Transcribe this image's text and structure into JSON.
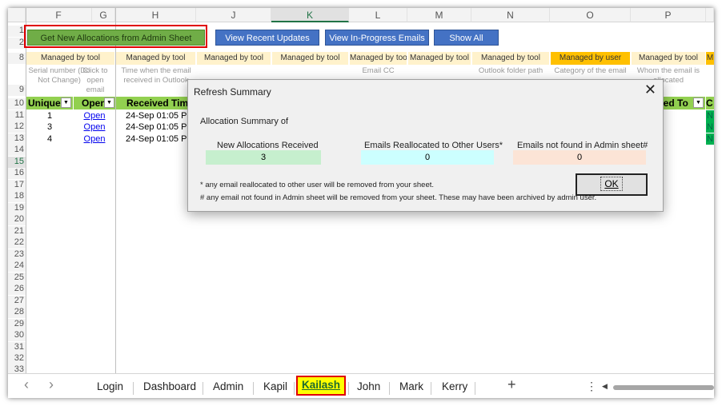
{
  "columns": [
    "F",
    "G",
    "H",
    "J",
    "K",
    "L",
    "M",
    "N",
    "O",
    "P"
  ],
  "rows": [
    "1",
    "2",
    "8",
    "9",
    "10",
    "11",
    "12",
    "13",
    "14",
    "15",
    "16",
    "17",
    "18",
    "19",
    "20",
    "21",
    "22",
    "23",
    "24",
    "25",
    "26",
    "27",
    "28",
    "29",
    "30",
    "31",
    "32",
    "33"
  ],
  "buttons": {
    "get_allocations": "Get New Allocations from Admin Sheet",
    "view_recent": "View Recent Updates",
    "view_inprogress": "View In-Progress Emails",
    "show_all": "Show All"
  },
  "managed": {
    "tool": "Managed by tool",
    "tool_trunc": "Managed by tool",
    "user": "Managed by user",
    "last": "M"
  },
  "descriptions": {
    "serial": "Serial number (Do Not Change)",
    "click": "Click to open email",
    "time": "Time when the email received in Outlook",
    "email_cc": "Email CC",
    "folder": "Outlook folder path",
    "category": "Category of the email",
    "whom": "Whom the email is allocated"
  },
  "headers": {
    "unique": "Unique",
    "open": "Open",
    "received": "Received Time",
    "allocated": "ated To",
    "last": "C"
  },
  "data_rows": [
    {
      "serial": "1",
      "open": "Open",
      "time": "24-Sep 01:05 PM",
      "flag": "N"
    },
    {
      "serial": "3",
      "open": "Open",
      "time": "24-Sep 01:05 PM",
      "flag": "N"
    },
    {
      "serial": "4",
      "open": "Open",
      "time": "24-Sep 01:05 PM",
      "flag": "N"
    }
  ],
  "dialog": {
    "title": "Refresh Summary",
    "close": "✕",
    "subtitle": "Allocation Summary of",
    "new_label": "New Allocations Received",
    "reallocated_label": "Emails Reallocated to Other Users*",
    "notfound_label": "Emails not found in Admin sheet#",
    "new_value": "3",
    "reallocated_value": "0",
    "notfound_value": "0",
    "note1": "* any email reallocated to other user will be removed from your sheet.",
    "note2": "# any email not found in Admin sheet will be removed from your sheet. These may have been archived by admin user.",
    "ok": "OK"
  },
  "tabs": [
    "Login",
    "Dashboard",
    "Admin",
    "Kapil",
    "Kailash",
    "John",
    "Mark",
    "Kerry"
  ],
  "active_tab": "Kailash",
  "nav": {
    "prev": "‹",
    "next": "›",
    "add": "+",
    "more": "⋮",
    "scroll_left": "◀"
  },
  "colors": {
    "button_blue": "#4472c4",
    "button_green": "#70ad47",
    "header_green": "#92d050",
    "managed_tool": "#fff2cc",
    "managed_user": "#ffc000",
    "new_field": "#c6efce",
    "reallocated_field": "#ccffff",
    "notfound_field": "#fce4d6",
    "highlight": "#ff0000"
  }
}
